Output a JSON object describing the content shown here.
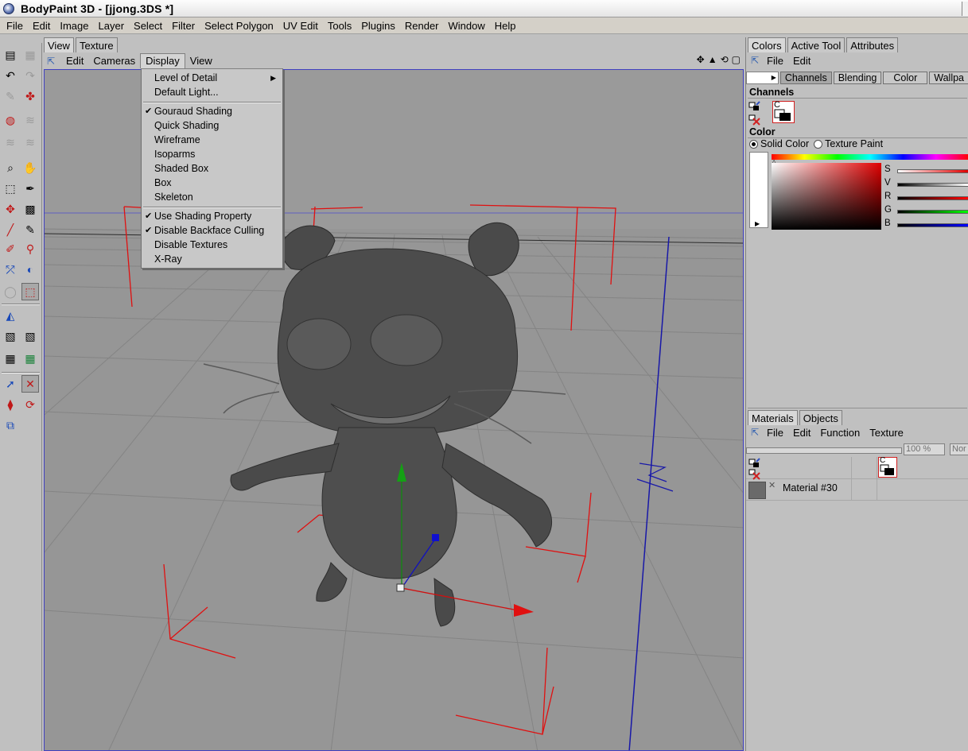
{
  "app": {
    "title": "BodyPaint 3D - [jjong.3DS *]"
  },
  "menubar": [
    "File",
    "Edit",
    "Image",
    "Layer",
    "Select",
    "Filter",
    "Select Polygon",
    "UV Edit",
    "Tools",
    "Plugins",
    "Render",
    "Window",
    "Help"
  ],
  "tool_icons": [
    "layout-icon",
    "undo-icon",
    "redo-icon",
    "brush-icon",
    "paint-icon",
    "palette-icon",
    "magnify-icon",
    "marquee-icon",
    "eyedropper-icon",
    "move-icon",
    "grid-icon",
    "pencil-icon",
    "picker-icon",
    "uv-icon",
    "transform-icon",
    "checker-icon",
    "select-arrow-icon",
    "scale-icon",
    "rotate-icon",
    "layers-icon"
  ],
  "viewport_panel": {
    "tabs": [
      "View",
      "Texture"
    ],
    "active_tab": "View",
    "menu": [
      "Edit",
      "Cameras",
      "Display",
      "View"
    ],
    "open_menu": "Display",
    "nav_icons": [
      "move-view-icon",
      "camera-rotate-icon",
      "zoom-icon",
      "maximize-icon"
    ]
  },
  "display_menu": {
    "group1": [
      {
        "label": "Level of Detail",
        "submenu": true
      },
      {
        "label": "Default Light..."
      }
    ],
    "group2": [
      {
        "label": "Gouraud Shading",
        "checked": true
      },
      {
        "label": "Quick Shading"
      },
      {
        "label": "Wireframe"
      },
      {
        "label": "Isoparms"
      },
      {
        "label": "Shaded Box"
      },
      {
        "label": "Box"
      },
      {
        "label": "Skeleton"
      }
    ],
    "group3": [
      {
        "label": "Use Shading Property",
        "checked": true
      },
      {
        "label": "Disable Backface Culling",
        "checked": true
      },
      {
        "label": "Disable Textures"
      },
      {
        "label": "X-Ray"
      }
    ]
  },
  "colors_panel": {
    "tabs": [
      "Colors",
      "Active Tool",
      "Attributes"
    ],
    "menu": [
      "File",
      "Edit"
    ],
    "channel_tabs": [
      "Channels",
      "Blending",
      "Color",
      "Wallpa"
    ],
    "channels_title": "Channels",
    "channel_label": "C",
    "color_title": "Color",
    "solid_color": "Solid Color",
    "texture_paint": "Texture Paint",
    "sliders": [
      "S",
      "V",
      "R",
      "G",
      "B"
    ],
    "colors": {
      "spectrum_red": "#ff0000",
      "selected": "#e00000"
    }
  },
  "materials_panel": {
    "tabs": [
      "Materials",
      "Objects"
    ],
    "menu": [
      "File",
      "Edit",
      "Function",
      "Texture"
    ],
    "zoom": "100 %",
    "mode": "Nor",
    "channel_label": "C",
    "material_name": "Material #30"
  }
}
